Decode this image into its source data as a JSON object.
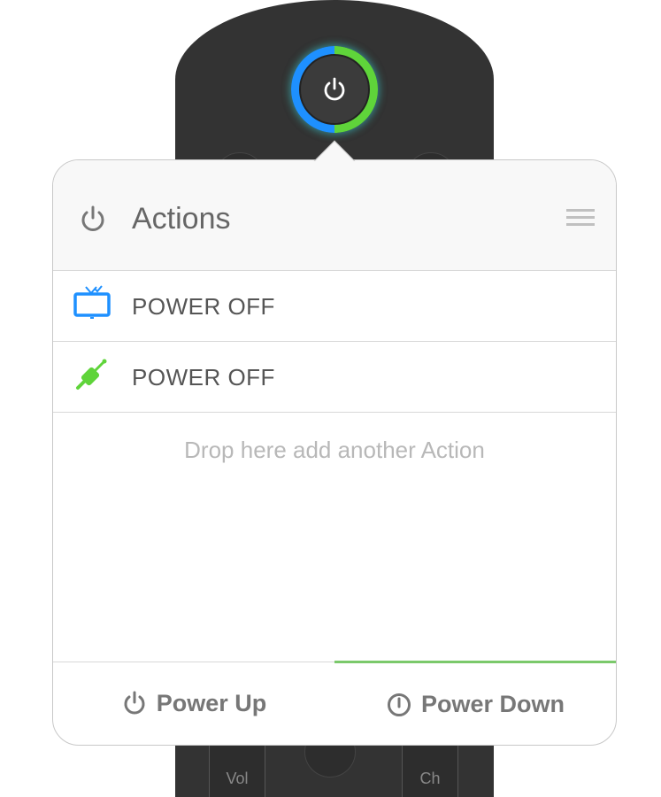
{
  "header": {
    "title": "Actions",
    "icon": "power-icon",
    "menu_icon": "hamburger-menu-icon"
  },
  "actions": [
    {
      "label": "POWER OFF",
      "icon": "tv-icon",
      "color": "#1e90ff"
    },
    {
      "label": "POWER OFF",
      "icon": "audio-jack-icon",
      "color": "#5fd43a"
    }
  ],
  "drop_hint": "Drop here add another Action",
  "tabs": {
    "power_up": "Power Up",
    "power_down": "Power Down",
    "active": "power_down"
  },
  "remote": {
    "vol_label": "Vol",
    "ch_label": "Ch"
  },
  "colors": {
    "accent_blue": "#1e90ff",
    "accent_green": "#5fd43a",
    "tab_active_underline": "#7bc96b"
  }
}
